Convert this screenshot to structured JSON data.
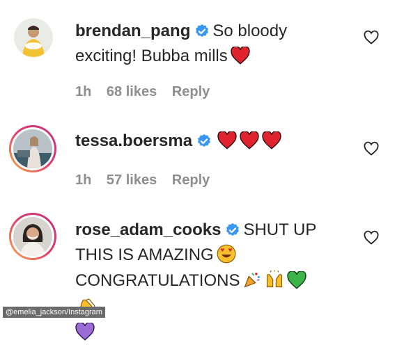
{
  "comments": [
    {
      "username": "brendan_pang",
      "text": "So bloody exciting! Bubba mills",
      "time": "1h",
      "likes": "68 likes",
      "reply": "Reply"
    },
    {
      "username": "tessa.boersma",
      "text": "",
      "time": "1h",
      "likes": "57 likes",
      "reply": "Reply"
    },
    {
      "username": "rose_adam_cooks",
      "text_line1": "SHUT UP",
      "text_line2": "THIS IS AMAZING",
      "text_line3": "CONGRATULATIONS"
    }
  ],
  "watermark": "@emelia_jackson/Instagram",
  "colors": {
    "heart_red": "#e0242f",
    "verified_blue": "#3897f0",
    "meta_gray": "#8e8e8e",
    "green_heart": "#3bb54a",
    "purple_heart": "#9b6bd6"
  },
  "icons": [
    "verified-badge-icon",
    "heart-outline-icon",
    "red-heart-emoji",
    "heart-eyes-emoji",
    "party-popper-emoji",
    "raising-hands-emoji",
    "green-heart-emoji",
    "clapping-hands-emoji",
    "purple-heart-emoji"
  ]
}
